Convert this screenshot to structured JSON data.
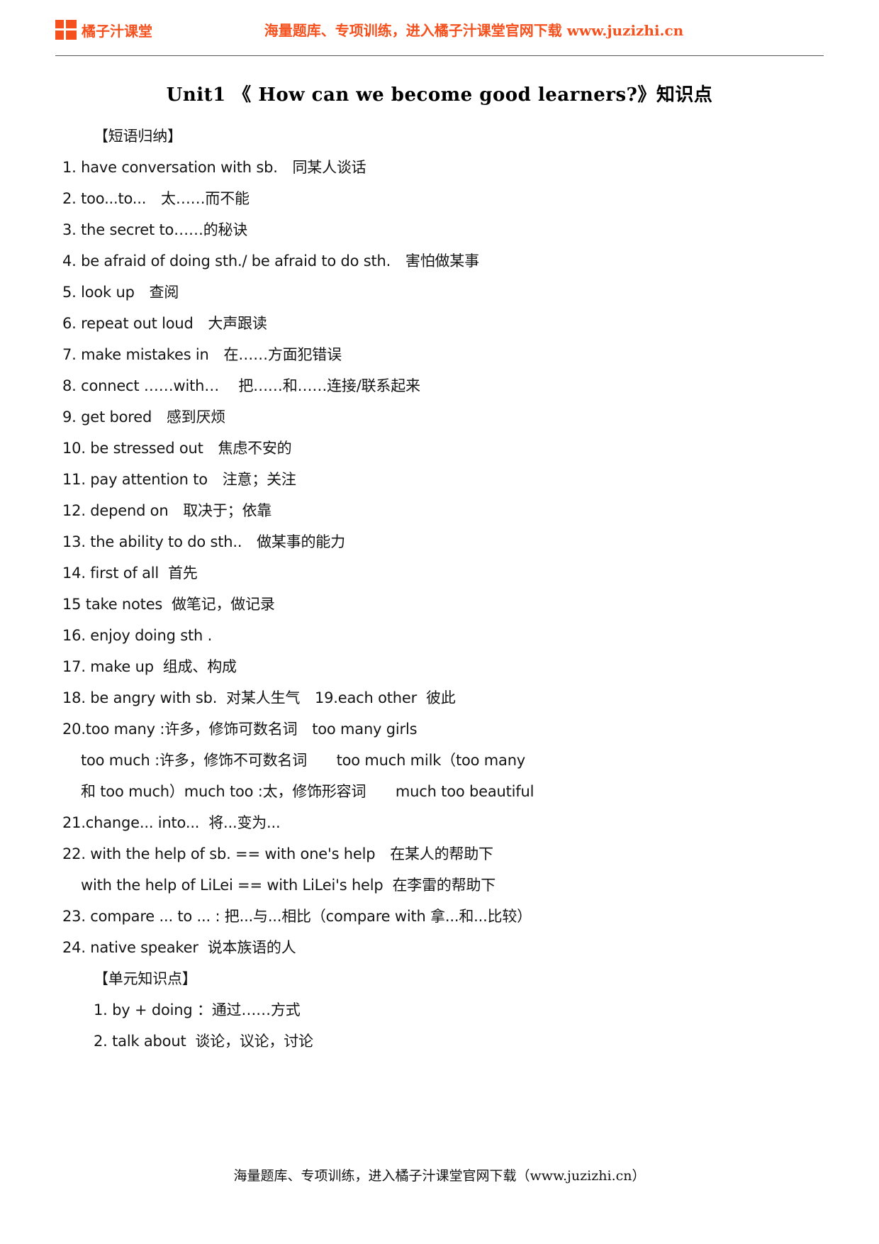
{
  "header": {
    "logo_icon": "orange-squares-logo-icon",
    "brand_name": "橘子汁课堂",
    "banner_text": "海量题库、专项训练，进入橘子汁课堂官网下载 www.juzizhi.cn",
    "accent_color": "#F4511E"
  },
  "title": "Unit1 《 How can we become good learners?》知识点",
  "sections": [
    {
      "heading": "【短语归纳】",
      "lines": [
        {
          "text": "1. have conversation with sb.　同某人谈话",
          "indent": 0
        },
        {
          "text": "2. too...to...　太……而不能",
          "indent": 0
        },
        {
          "text": "3. the secret to……的秘诀",
          "indent": 0
        },
        {
          "text": "4. be afraid of doing sth./ be afraid to do sth.　害怕做某事",
          "indent": 0
        },
        {
          "text": "5. look up　查阅",
          "indent": 0
        },
        {
          "text": "6. repeat out loud　大声跟读",
          "indent": 0
        },
        {
          "text": "7. make mistakes in　在……方面犯错误",
          "indent": 0
        },
        {
          "text": "8. connect ……with…　 把……和……连接/联系起来",
          "indent": 0
        },
        {
          "text": "9. get bored　感到厌烦",
          "indent": 0
        },
        {
          "text": "10. be stressed out　焦虑不安的",
          "indent": 0
        },
        {
          "text": "11. pay attention to　注意；关注",
          "indent": 0
        },
        {
          "text": "12. depend on　取决于；依靠",
          "indent": 0
        },
        {
          "text": "13. the ability to do sth..　做某事的能力",
          "indent": 0
        },
        {
          "text": "14. first of all  首先",
          "indent": 0
        },
        {
          "text": "15 take notes  做笔记，做记录",
          "indent": 0
        },
        {
          "text": "16. enjoy doing sth .",
          "indent": 0
        },
        {
          "text": "17. make up  组成、构成",
          "indent": 0
        },
        {
          "text": "18. be angry with sb.  对某人生气　19.each other  彼此",
          "indent": 0
        },
        {
          "text": "20.too many :许多，修饰可数名词　too many girls",
          "indent": 0
        },
        {
          "text": "too much :许多，修饰不可数名词　　too much milk（too many",
          "indent": 1
        },
        {
          "text": "和 too much）much too :太，修饰形容词　　much too beautiful",
          "indent": 1
        },
        {
          "text": "21.change... into...  将...变为...",
          "indent": 0
        },
        {
          "text": "22. with the help of sb. == with one's help　在某人的帮助下",
          "indent": 0
        },
        {
          "text": "with the help of LiLei == with LiLei's help  在李雷的帮助下",
          "indent": 1
        },
        {
          "text": "23. compare ... to ... : 把...与...相比（compare with 拿...和...比较）",
          "indent": 0
        },
        {
          "text": "24. native speaker  说本族语的人",
          "indent": 0
        }
      ]
    },
    {
      "heading": "【单元知识点】",
      "lines": [
        {
          "text": "1. by + doing ：通过……方式",
          "indent": 2
        },
        {
          "text": "2. talk about  谈论，议论，讨论",
          "indent": 2
        }
      ]
    }
  ],
  "footer": {
    "text": "海量题库、专项训练，进入橘子汁课堂官网下载（www.juzizhi.cn）"
  }
}
